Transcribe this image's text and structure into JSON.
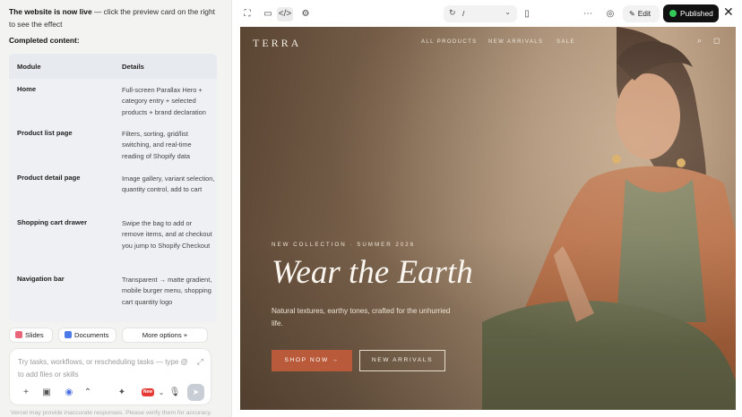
{
  "chat": {
    "intro_bold": "The website is now live",
    "intro_rest": " — click the preview card on the right to see the effect",
    "completed_title": "Completed content:",
    "table": {
      "headers": [
        "Module",
        "Details"
      ],
      "rows": [
        {
          "module": "Home",
          "details": "Full-screen Parallax Hero + category entry + selected products + brand declaration"
        },
        {
          "module": "Product list page",
          "details": "Filters, sorting, grid/list switching, and real-time reading of Shopify data"
        },
        {
          "module": "Product detail page",
          "details": "Image gallery, variant selection, quantity control, add to cart"
        },
        {
          "module": "Shopping cart drawer",
          "details": "Swipe the bag to add or remove items, and at checkout you jump to Shopify Checkout"
        },
        {
          "module": "Navigation bar",
          "details": "Transparent → matte gradient, mobile burger menu, shopping cart quantity logo"
        }
      ]
    },
    "chips": {
      "slides": "Slides",
      "documents": "Documents",
      "more": "More options +"
    },
    "composer": {
      "placeholder": "Try tasks, workflows, or rescheduling tasks — type @ to add files or skills",
      "new_badge": "New"
    },
    "footnote": "Vercel may provide inaccurate responses. Please verify them for accuracy."
  },
  "preview": {
    "url_path": "/",
    "edit_label": "Edit",
    "publish_label": "Published",
    "colors": {
      "publish_dot": "#34c759",
      "cta": "#b95a3a"
    },
    "site": {
      "brand": "TERRA",
      "nav": [
        "ALL PRODUCTS",
        "NEW ARRIVALS",
        "SALE"
      ],
      "eyebrow": "NEW COLLECTION · SUMMER 2026",
      "headline": "Wear the Earth",
      "subtitle": "Natural textures, earthy tones, crafted for the unhurried life.",
      "cta_primary": "SHOP NOW →",
      "cta_secondary": "NEW ARRIVALS"
    }
  }
}
